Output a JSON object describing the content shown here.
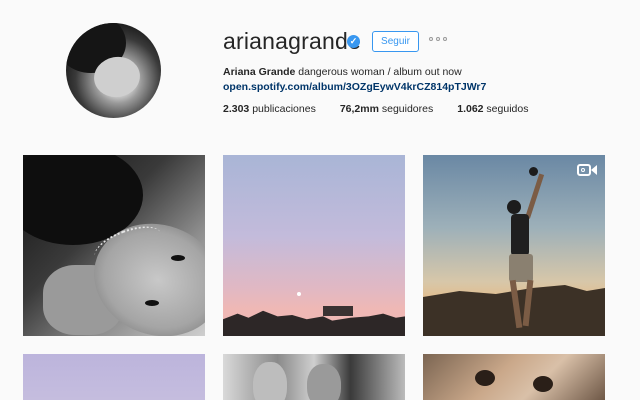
{
  "profile": {
    "username": "arianagrande",
    "follow_label": "Seguir",
    "bio_name": "Ariana Grande",
    "bio_text": " dangerous woman / album out now ",
    "bio_link": "open.spotify.com/album/3OZgEywV4krCZ814pTJWr7",
    "stats": {
      "posts_count": "2.303",
      "posts_label": " publicaciones",
      "followers_count": "76,2mm",
      "followers_label": " seguidores",
      "following_count": "1.062",
      "following_label": " seguidos"
    },
    "verified_icon": "verified-badge-icon",
    "accent_color": "#3897f0"
  },
  "posts": [
    {
      "kind": "photo"
    },
    {
      "kind": "photo"
    },
    {
      "kind": "video",
      "icon": "video-camera-icon"
    },
    {
      "kind": "photo"
    },
    {
      "kind": "photo"
    },
    {
      "kind": "photo"
    }
  ]
}
